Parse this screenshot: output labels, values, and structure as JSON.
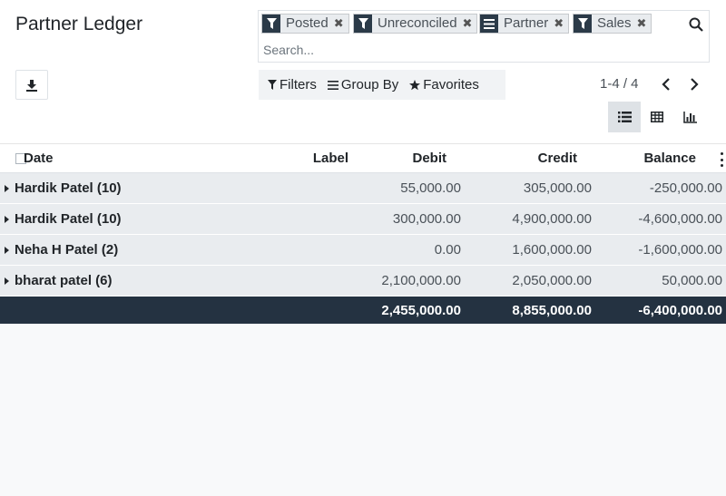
{
  "page": {
    "title": "Partner Ledger"
  },
  "search": {
    "placeholder": "Search...",
    "facets": [
      {
        "icon": "filter-icon",
        "label": "Posted"
      },
      {
        "icon": "filter-icon",
        "label": "Unreconciled"
      },
      {
        "icon": "group-by-icon",
        "label": "Partner"
      },
      {
        "icon": "filter-icon",
        "label": "Sales"
      }
    ]
  },
  "toolbar": {
    "filters_label": "Filters",
    "group_by_label": "Group By",
    "favorites_label": "Favorites"
  },
  "pager": {
    "value": "1-4 / 4"
  },
  "table": {
    "columns": {
      "date": "Date",
      "label": "Label",
      "debit": "Debit",
      "credit": "Credit",
      "balance": "Balance"
    },
    "groups": [
      {
        "name": "Hardik Patel (10)",
        "debit": "55,000.00",
        "credit": "305,000.00",
        "balance": "-250,000.00"
      },
      {
        "name": "Hardik Patel (10)",
        "debit": "300,000.00",
        "credit": "4,900,000.00",
        "balance": "-4,600,000.00"
      },
      {
        "name": "Neha H Patel (2)",
        "debit": "0.00",
        "credit": "1,600,000.00",
        "balance": "-1,600,000.00"
      },
      {
        "name": "bharat patel (6)",
        "debit": "2,100,000.00",
        "credit": "2,050,000.00",
        "balance": "50,000.00"
      }
    ],
    "totals": {
      "debit": "2,455,000.00",
      "credit": "8,855,000.00",
      "balance": "-6,400,000.00"
    }
  },
  "colors": {
    "dark_header": "#243241",
    "facet_icon_bg": "#2b3a48",
    "group_row_bg": "#e9ecef"
  }
}
